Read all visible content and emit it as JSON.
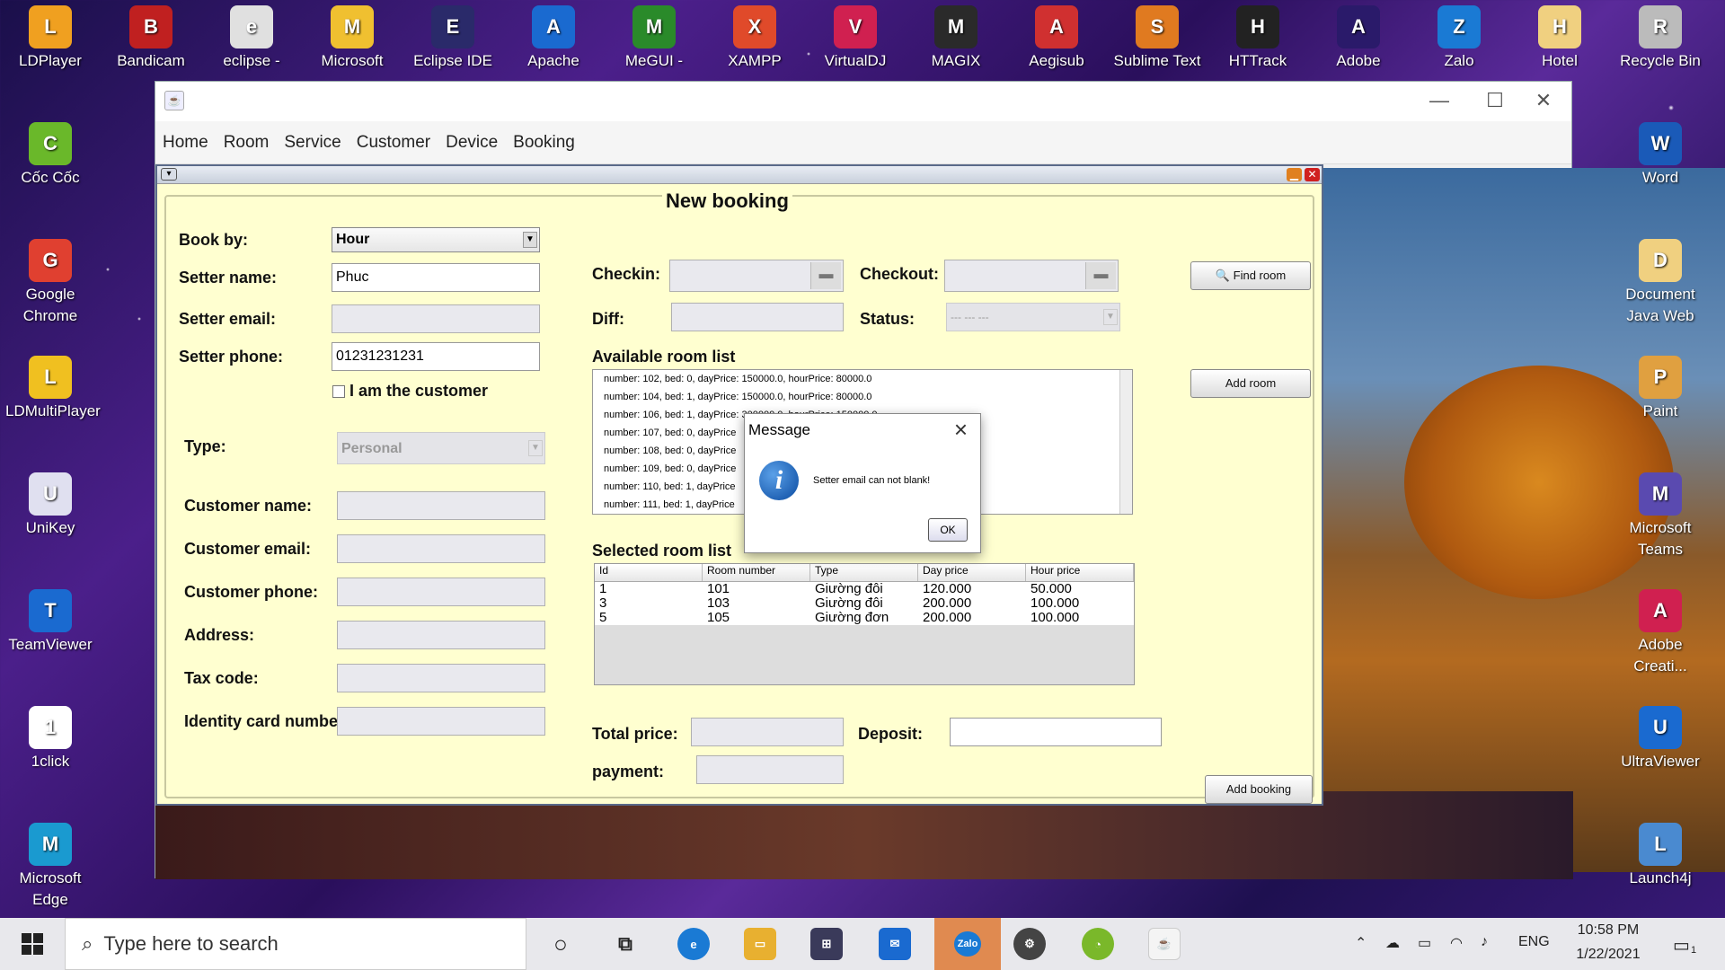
{
  "desktop_icons_top": [
    "LDPlayer",
    "Bandicam",
    "eclipse -",
    "Microsoft",
    "Eclipse IDE",
    "Apache",
    "MeGUI -",
    "XAMPP",
    "VirtualDJ",
    "MAGIX",
    "Aegisub",
    "Sublime Text",
    "HTTrack",
    "Adobe",
    "Zalo",
    "Hotel",
    "Recycle Bin"
  ],
  "desktop_icons_left": [
    "Cốc Cốc",
    "Google Chrome",
    "LDMultiPlayer",
    "UniKey",
    "TeamViewer",
    "1click",
    "Microsoft Edge"
  ],
  "desktop_icons_right": [
    "Word",
    "Document Java Web",
    "Paint",
    "Microsoft Teams",
    "Adobe Creati...",
    "UltraViewer",
    "Launch4j"
  ],
  "menu": [
    "Home",
    "Room",
    "Service",
    "Customer",
    "Device",
    "Booking"
  ],
  "form": {
    "title": "New booking",
    "book_by_label": "Book by:",
    "book_by_value": "Hour",
    "setter_name_label": "Setter name:",
    "setter_name_value": "Phuc",
    "setter_email_label": "Setter email:",
    "setter_email_value": "",
    "setter_phone_label": "Setter phone:",
    "setter_phone_value": "01231231231",
    "customer_checkbox_label": "I am the customer",
    "type_label": "Type:",
    "type_value": "Personal",
    "customer_name_label": "Customer name:",
    "customer_email_label": "Customer email:",
    "customer_phone_label": "Customer phone:",
    "address_label": "Address:",
    "tax_code_label": "Tax code:",
    "identity_label": "Identity card number:",
    "checkin_label": "Checkin:",
    "checkout_label": "Checkout:",
    "diff_label": "Diff:",
    "status_label": "Status:",
    "status_value": "--- --- ---",
    "find_room": "Find room",
    "available_label": "Available room list",
    "available_rooms": [
      "number: 102, bed: 0, dayPrice: 150000.0, hourPrice: 80000.0",
      "number: 104, bed: 1, dayPrice: 150000.0, hourPrice: 80000.0",
      "number: 106, bed: 1, dayPrice: 300000.0, hourPrice: 150000.0",
      "number: 107, bed: 0, dayPrice",
      "number: 108, bed: 0, dayPrice",
      "number: 109, bed: 0, dayPrice",
      "number: 110, bed: 1, dayPrice",
      "number: 111, bed: 1, dayPrice"
    ],
    "add_room": "Add room",
    "selected_label": "Selected room list",
    "table_headers": [
      "Id",
      "Room number",
      "Type",
      "Day price",
      "Hour price"
    ],
    "table_rows": [
      [
        "1",
        "101",
        "Giường đôi",
        "120.000",
        "50.000"
      ],
      [
        "3",
        "103",
        "Giường đôi",
        "200.000",
        "100.000"
      ],
      [
        "5",
        "105",
        "Giường đơn",
        "200.000",
        "100.000"
      ]
    ],
    "total_price_label": "Total price:",
    "deposit_label": "Deposit:",
    "payment_label": "payment:",
    "add_booking": "Add booking"
  },
  "dialog": {
    "title": "Message",
    "message": "Setter email can not blank!",
    "ok": "OK"
  },
  "taskbar": {
    "search_placeholder": "Type here to search",
    "lang": "ENG",
    "time": "10:58 PM",
    "date": "1/22/2021",
    "notif_count": "1"
  }
}
